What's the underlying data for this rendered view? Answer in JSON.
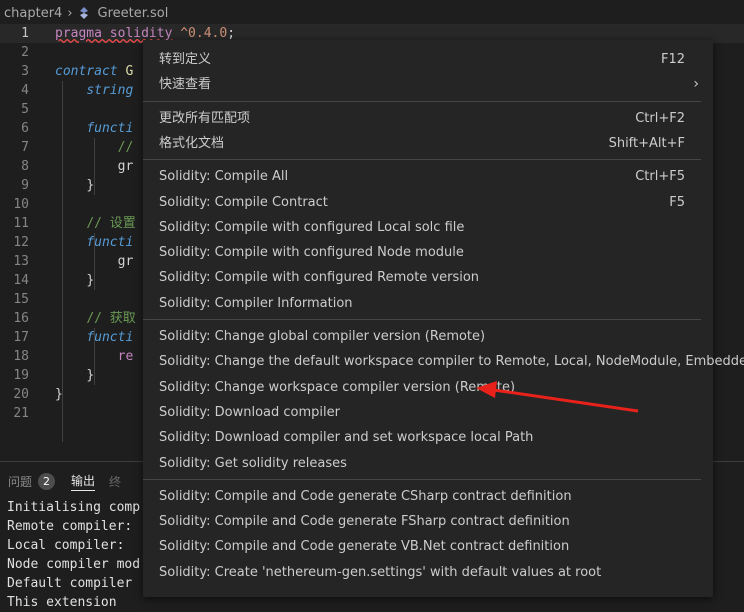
{
  "breadcrumb": {
    "folder": "chapter4",
    "file": "Greeter.sol"
  },
  "editor": {
    "lines": [
      {
        "n": "1",
        "html": "<span class='err'>pragma solidity</span> <span class='str'>^0.4.0</span><span class='pl'>;</span>"
      },
      {
        "n": "2",
        "html": ""
      },
      {
        "n": "3",
        "html": "<span class='kw'>contract</span> <span class='fn'>G</span>"
      },
      {
        "n": "4",
        "html": "    <span class='kw'>string</span>"
      },
      {
        "n": "5",
        "html": ""
      },
      {
        "n": "6",
        "html": "    <span class='kw'>functi</span>"
      },
      {
        "n": "7",
        "html": "        <span class='cm'>//</span>"
      },
      {
        "n": "8",
        "html": "        <span class='pl'>gr</span>"
      },
      {
        "n": "9",
        "html": "    <span class='pl'>}</span>"
      },
      {
        "n": "10",
        "html": ""
      },
      {
        "n": "11",
        "html": "    <span class='cm'>// 设置</span>"
      },
      {
        "n": "12",
        "html": "    <span class='kw'>functi</span>"
      },
      {
        "n": "13",
        "html": "        <span class='pl'>gr</span>"
      },
      {
        "n": "14",
        "html": "    <span class='pl'>}</span>"
      },
      {
        "n": "15",
        "html": ""
      },
      {
        "n": "16",
        "html": "    <span class='cm'>// 获取</span>"
      },
      {
        "n": "17",
        "html": "    <span class='kw'>functi</span>"
      },
      {
        "n": "18",
        "html": "        <span class='ret'>re</span>"
      },
      {
        "n": "19",
        "html": "    <span class='pl'>}</span>"
      },
      {
        "n": "20",
        "html": "<span class='pl'>}</span>"
      },
      {
        "n": "21",
        "html": ""
      }
    ]
  },
  "panel": {
    "tab_problems": "问题",
    "problems_count": "2",
    "tab_output": "输出",
    "tab_partial": "终",
    "output_lines": [
      "Initialising comp",
      "Remote compiler:",
      "Local compiler:",
      "Node compiler mod",
      "Default compiler",
      "This extension"
    ]
  },
  "menu": {
    "groups": [
      [
        {
          "label": "转到定义",
          "shortcut": "F12"
        },
        {
          "label": "快速查看",
          "submenu": true
        }
      ],
      [
        {
          "label": "更改所有匹配项",
          "shortcut": "Ctrl+F2"
        },
        {
          "label": "格式化文档",
          "shortcut": "Shift+Alt+F"
        }
      ],
      [
        {
          "label": "Solidity: Compile All",
          "shortcut": "Ctrl+F5"
        },
        {
          "label": "Solidity: Compile Contract",
          "shortcut": "F5"
        },
        {
          "label": "Solidity: Compile with configured Local solc file"
        },
        {
          "label": "Solidity: Compile with configured Node module"
        },
        {
          "label": "Solidity: Compile with configured Remote version"
        },
        {
          "label": "Solidity: Compiler Information"
        }
      ],
      [
        {
          "label": "Solidity: Change global compiler version (Remote)"
        },
        {
          "label": "Solidity: Change the default workspace compiler to Remote, Local, NodeModule, Embedded"
        },
        {
          "label": "Solidity: Change workspace compiler version (Remote)"
        },
        {
          "label": "Solidity: Download compiler"
        },
        {
          "label": "Solidity: Download compiler and set workspace local Path"
        },
        {
          "label": "Solidity: Get solidity releases"
        }
      ],
      [
        {
          "label": "Solidity: Compile and Code generate CSharp contract definition"
        },
        {
          "label": "Solidity: Compile and Code generate FSharp contract definition"
        },
        {
          "label": "Solidity: Compile and Code generate VB.Net contract definition"
        },
        {
          "label": "Solidity: Create 'nethereum-gen.settings' with default values at root"
        }
      ]
    ],
    "submenu_glyph": "›"
  },
  "colors": {
    "arrow": "#e8221b"
  }
}
